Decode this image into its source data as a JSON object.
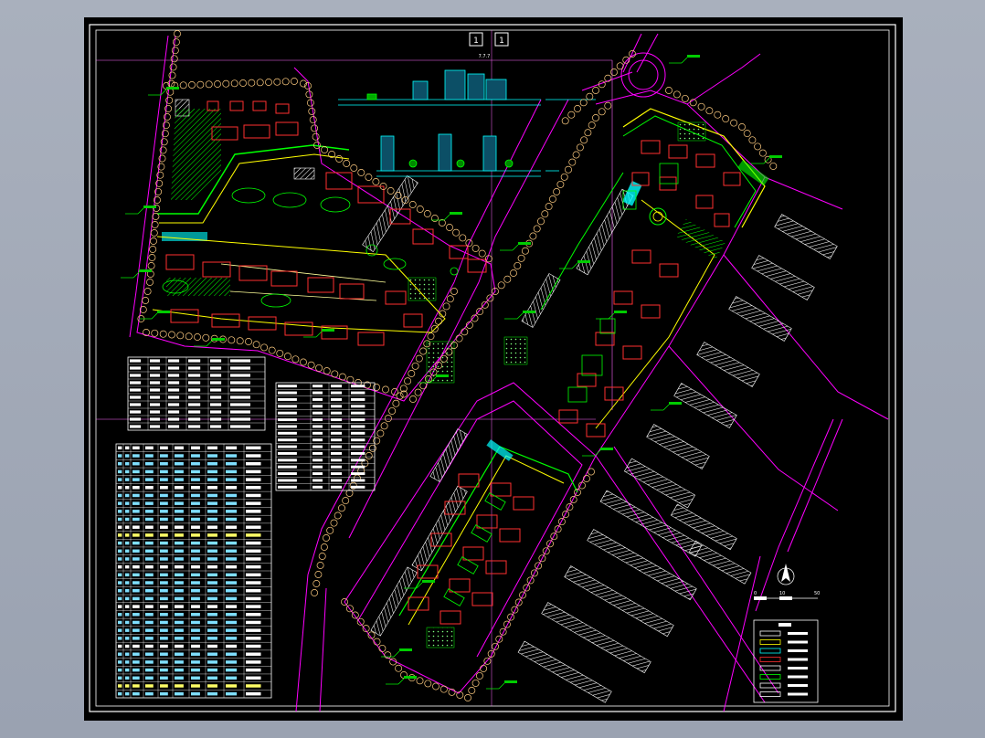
{
  "header": {
    "sheet_tab_1": "1",
    "sheet_tab_2": "1",
    "top_label": "7.7.7"
  },
  "north_arrow": {
    "scale_start": "0",
    "scale_mid": "10",
    "scale_end": "50"
  },
  "colors": {
    "background": "#000000",
    "frame": "#ffffff",
    "magenta": "#ff00ff",
    "cyan": "#00ffff",
    "green": "#00ff00",
    "yellow": "#ffff00",
    "red": "#ff3030",
    "pale_yellow": "#ffff99"
  },
  "icons": [
    "north-arrow-icon",
    "tree-symbol-icon"
  ]
}
